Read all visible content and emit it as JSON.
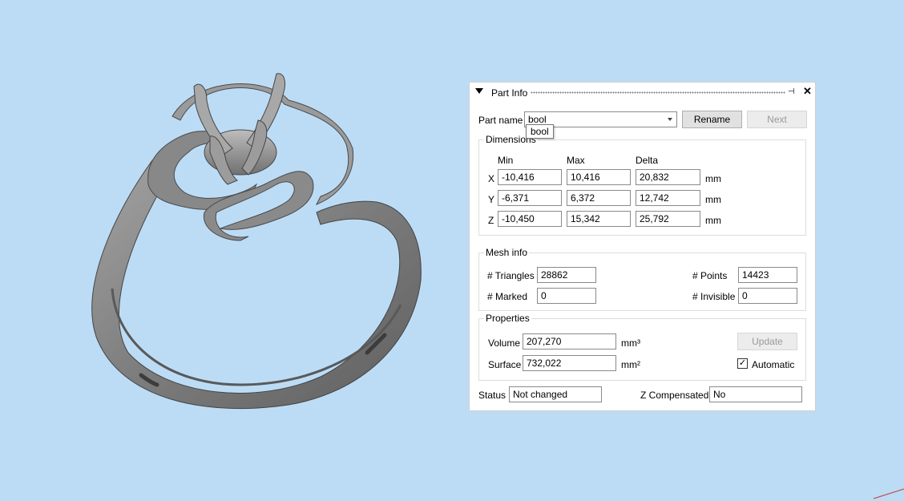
{
  "panel": {
    "title": "Part Info",
    "pin_icon": "pin-icon",
    "close_icon": "close-icon",
    "close_glyph": "✕",
    "pin_glyph": "⊣"
  },
  "part": {
    "name_label": "Part name",
    "name_value": "bool",
    "tooltip": "bool",
    "rename_label": "Rename",
    "next_label": "Next"
  },
  "dimensions": {
    "title": "Dimensions",
    "headers": [
      "Min",
      "Max",
      "Delta"
    ],
    "rows": [
      {
        "axis": "X",
        "min": "-10,416",
        "max": "10,416",
        "delta": "20,832",
        "unit": "mm"
      },
      {
        "axis": "Y",
        "min": "-6,371",
        "max": "6,372",
        "delta": "12,742",
        "unit": "mm"
      },
      {
        "axis": "Z",
        "min": "-10,450",
        "max": "15,342",
        "delta": "25,792",
        "unit": "mm"
      }
    ]
  },
  "mesh": {
    "title": "Mesh info",
    "triangles_label": "# Triangles",
    "triangles_value": "28862",
    "points_label": "# Points",
    "points_value": "14423",
    "marked_label": "# Marked",
    "marked_value": "0",
    "invisible_label": "# Invisible",
    "invisible_value": "0"
  },
  "properties": {
    "title": "Properties",
    "volume_label": "Volume",
    "volume_value": "207,270",
    "volume_unit": "mm³",
    "surface_label": "Surface",
    "surface_value": "732,022",
    "surface_unit": "mm²",
    "update_label": "Update",
    "automatic_label": "Automatic",
    "automatic_checked": true,
    "check_glyph": "✓"
  },
  "status": {
    "status_label": "Status",
    "status_value": "Not changed",
    "zcomp_label": "Z Compensated",
    "zcomp_value": "No"
  },
  "colors": {
    "viewport_bg": "#bcdcf6",
    "model_fill": "#8e8e8e"
  }
}
